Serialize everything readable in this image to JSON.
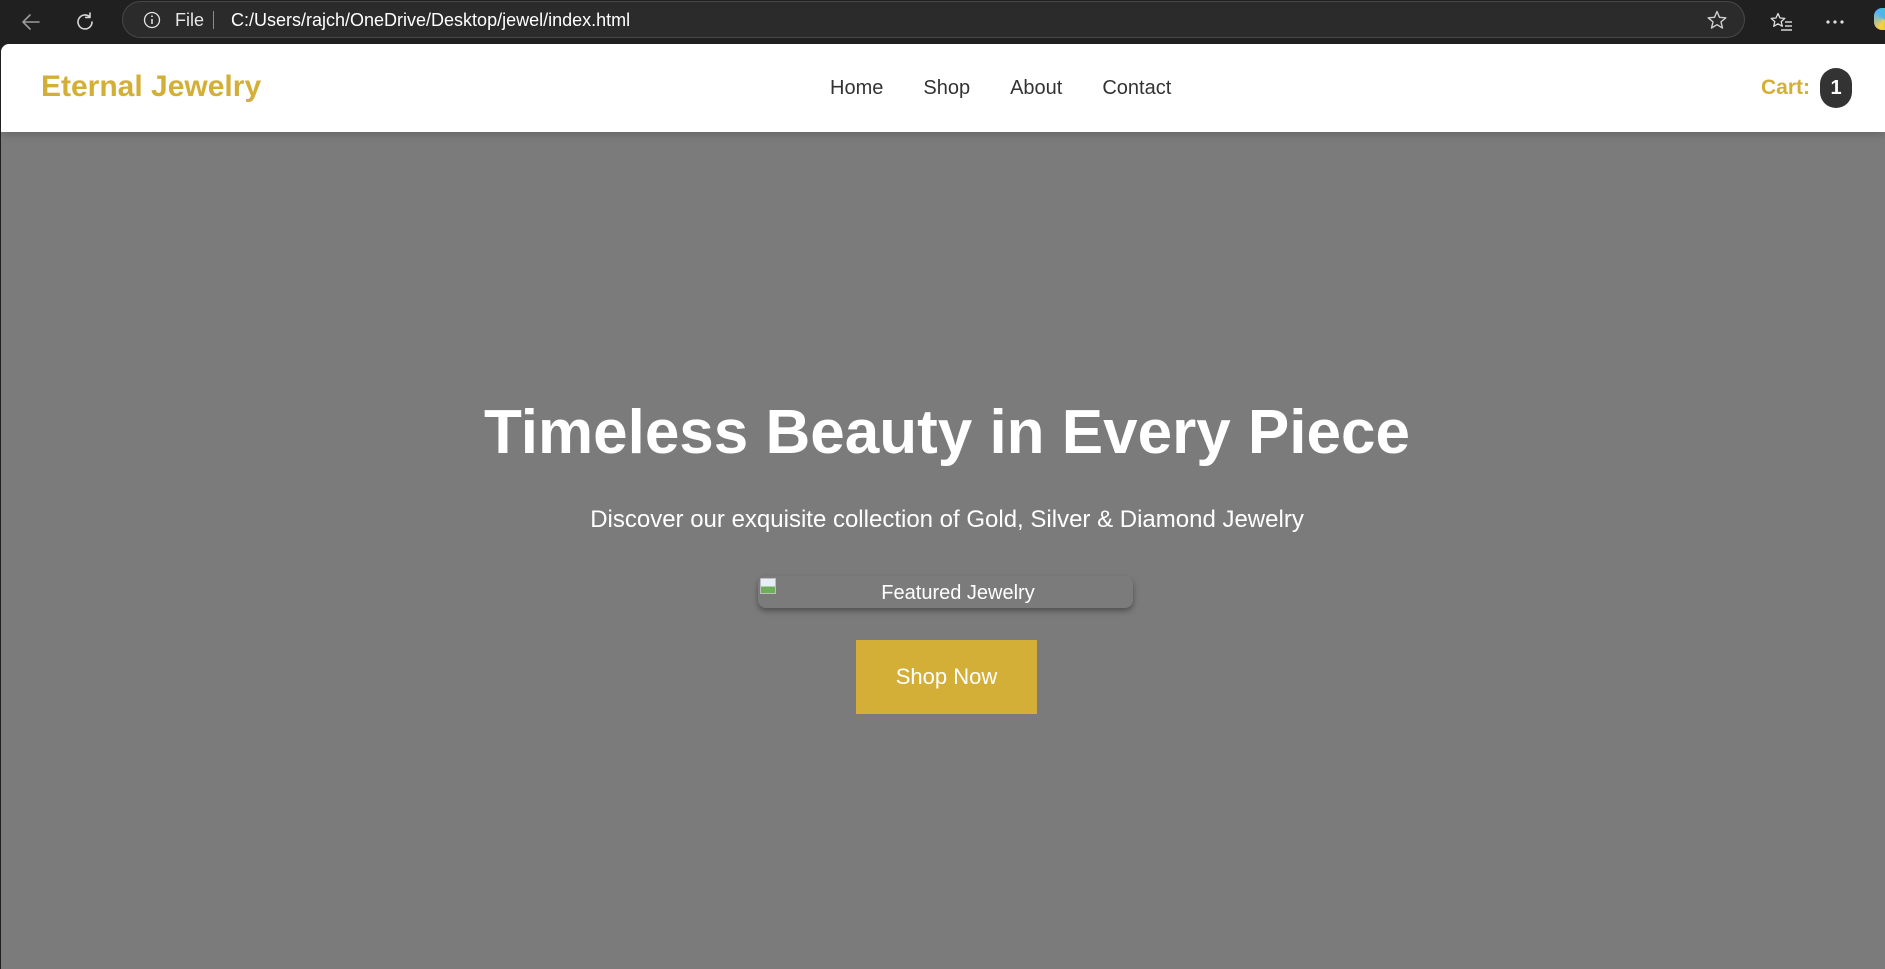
{
  "browser": {
    "address_scheme": "File",
    "url": "C:/Users/rajch/OneDrive/Desktop/jewel/index.html",
    "icons": {
      "back": "arrow-left-icon",
      "reload": "reload-icon",
      "info": "info-icon",
      "favorite": "star-icon",
      "favorites_list": "favorites-list-icon",
      "more": "ellipsis-icon",
      "copilot": "copilot-icon"
    }
  },
  "site": {
    "logo": "Eternal Jewelry",
    "nav": [
      "Home",
      "Shop",
      "About",
      "Contact"
    ],
    "cart_label": "Cart:",
    "cart_count": "1"
  },
  "hero": {
    "title": "Timeless Beauty in Every Piece",
    "subtitle": "Discover our exquisite collection of Gold, Silver & Diamond Jewelry",
    "featured_image_alt": "Featured Jewelry",
    "cta_label": "Shop Now"
  },
  "colors": {
    "accent_gold": "#d4af37",
    "hero_overlay": "#7b7b7b",
    "header_bg": "#ffffff",
    "nav_text": "#333333",
    "cart_badge_bg": "#333333",
    "browser_chrome": "#202020"
  }
}
